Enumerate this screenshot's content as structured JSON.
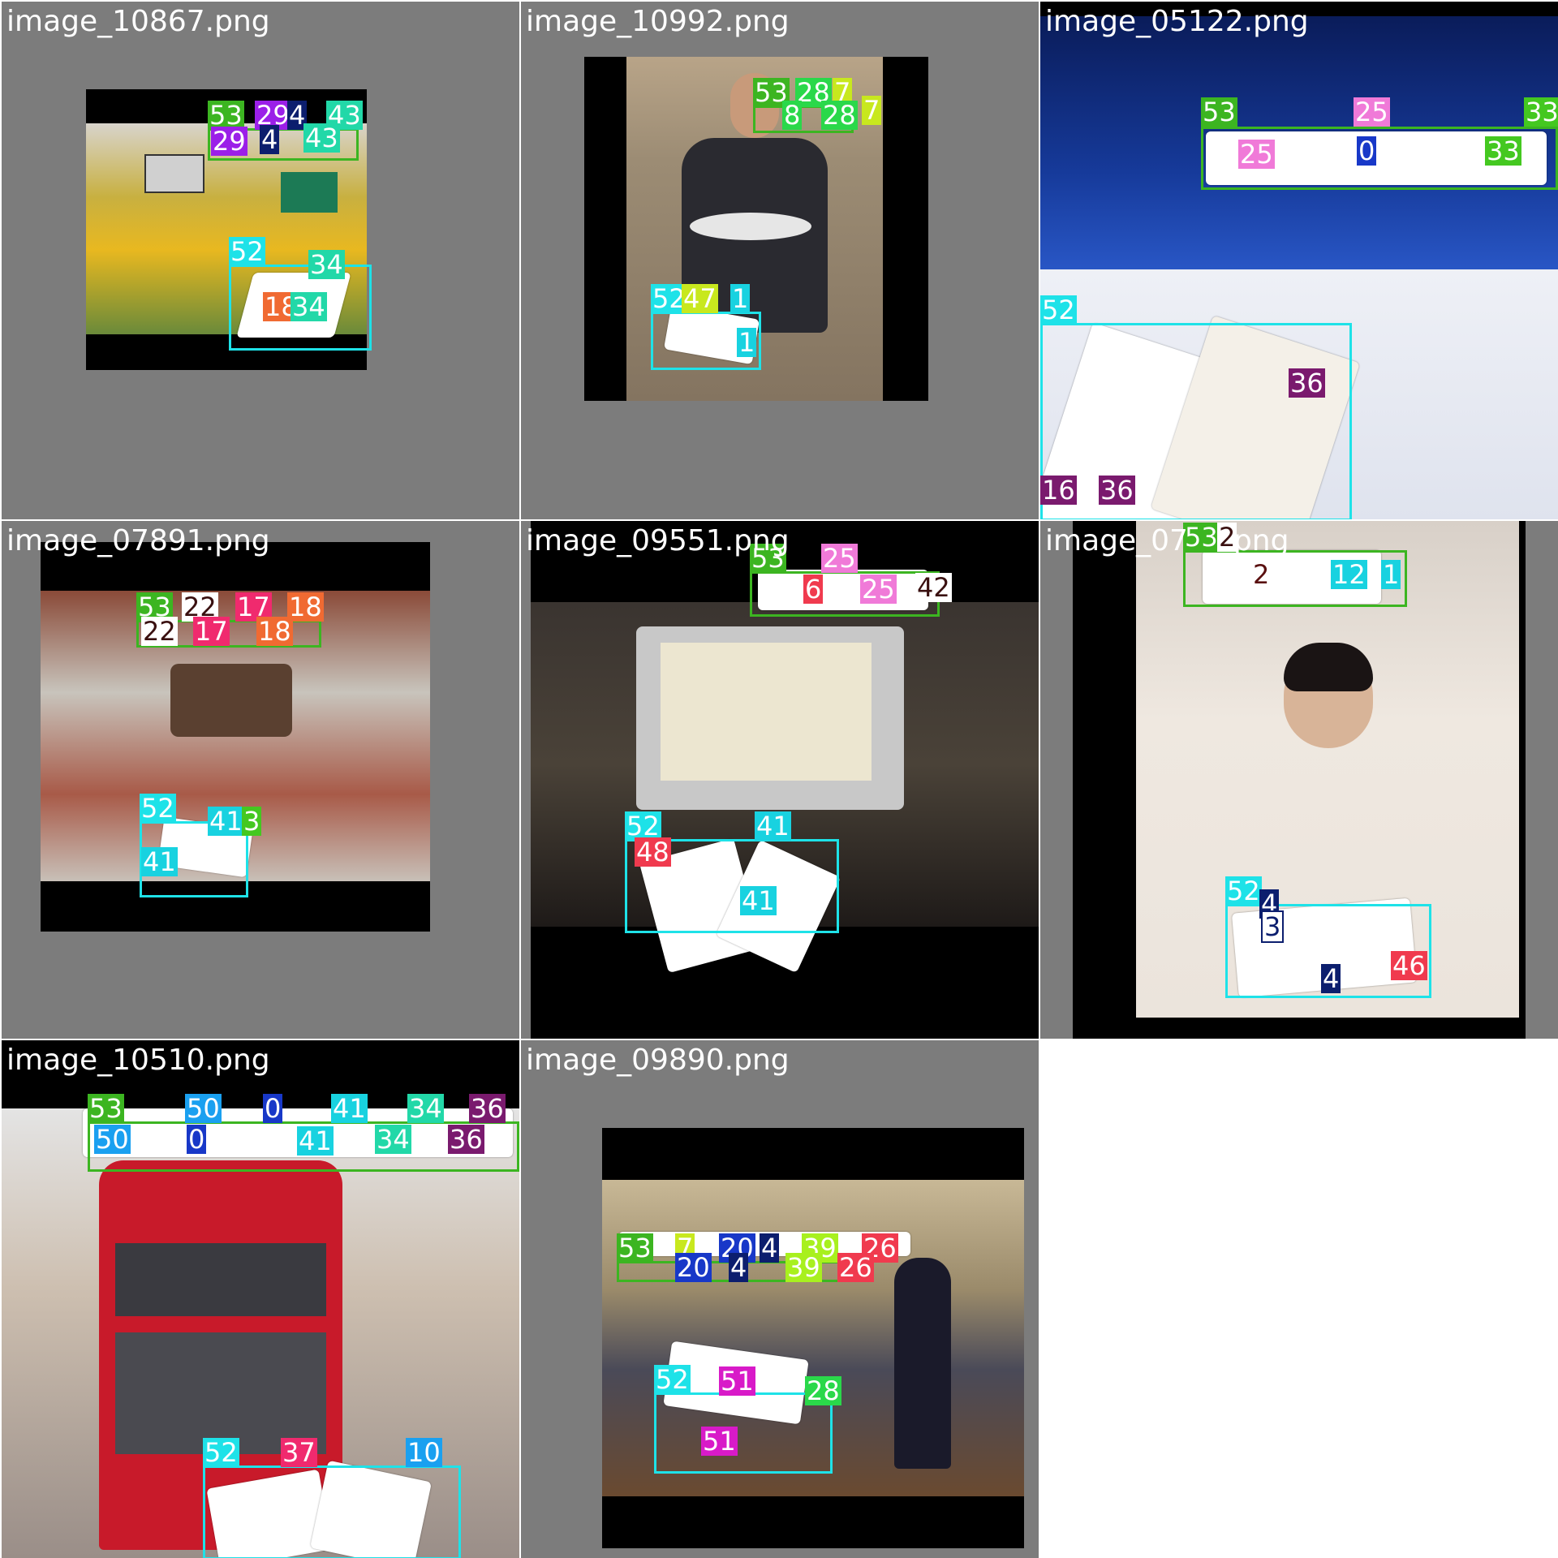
{
  "tiles": [
    {
      "filename": "image_10867.png",
      "labels": [
        "53",
        "29",
        "4",
        "43",
        "29",
        "4",
        "43",
        "52",
        "34",
        "18",
        "34"
      ]
    },
    {
      "filename": "image_10992.png",
      "labels": [
        "53",
        "28",
        "7",
        "8",
        "28",
        "7",
        "52",
        "47",
        "1",
        "1"
      ]
    },
    {
      "filename": "image_05122.png",
      "labels": [
        "53",
        "25",
        "33",
        "25",
        "0",
        "33",
        "52",
        "36",
        "16",
        "36"
      ]
    },
    {
      "filename": "image_07891.png",
      "labels": [
        "53",
        "22",
        "17",
        "18",
        "22",
        "17",
        "18",
        "52",
        "41",
        "3",
        "41"
      ]
    },
    {
      "filename": "image_09551.png",
      "labels": [
        "53",
        "25",
        "6",
        "25",
        "42",
        "52",
        "41",
        "48",
        "41"
      ]
    },
    {
      "filename": "image_07",
      "filename_tail": "png",
      "labels": [
        "53",
        "2",
        "2",
        "12",
        "1",
        "52",
        "4",
        "3",
        "4",
        "46"
      ]
    },
    {
      "filename": "image_10510.png",
      "labels": [
        "53",
        "50",
        "0",
        "41",
        "34",
        "36",
        "50",
        "0",
        "41",
        "34",
        "36",
        "52",
        "37",
        "10"
      ]
    },
    {
      "filename": "image_09890.png",
      "labels": [
        "53",
        "7",
        "20",
        "4",
        "39",
        "26",
        "20",
        "4",
        "39",
        "26",
        "52",
        "51",
        "28",
        "51"
      ]
    }
  ],
  "colors": {
    "background": "#7c7c7c",
    "c53": "#3cb521",
    "c52": "#1ee2e8",
    "c29": "#9b1fe8",
    "c4": "#0c1e6e",
    "c43": "#22d8a8",
    "c34": "#22d8a8",
    "c18": "#f06a32",
    "c28": "#2ad84a",
    "c7": "#c8e81e",
    "c8": "#2ad84a",
    "c47": "#c8e81e",
    "c1": "#18d2e0",
    "c25": "#f07ad8",
    "c33": "#44c820",
    "c0": "#1838c8",
    "c36": "#7a1a6e",
    "c16": "#7a1a6e",
    "c22": "#ffffff",
    "c17": "#f02a6e",
    "c41": "#18d2e0",
    "c3": "#44c820",
    "c6": "#f03a4e",
    "c42": "#ffffff",
    "c48": "#f03a4e",
    "c2": "#ffffff",
    "c12": "#18d2e0",
    "c46": "#f03a4e",
    "c50": "#1aa0f0",
    "c37": "#f02a6e",
    "c10": "#1aa0f0",
    "c51": "#d81ac8",
    "c20": "#1838c8",
    "c39": "#a8f01e",
    "c26": "#f03a4e"
  }
}
